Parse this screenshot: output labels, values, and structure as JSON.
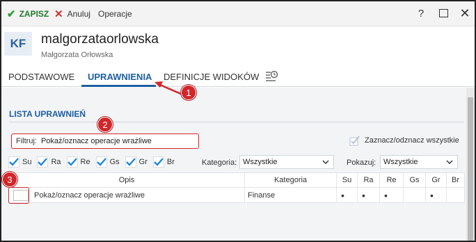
{
  "toolbar": {
    "save_label": "ZAPISZ",
    "cancel_label": "Anuluj",
    "operations_label": "Operacje"
  },
  "header": {
    "avatar_initials": "KF",
    "login": "malgorzataorlowska",
    "full_name": "Małgorzata Orłowska"
  },
  "tabs": [
    {
      "label": "PODSTAWOWE",
      "active": false
    },
    {
      "label": "UPRAWNIENIA",
      "active": true
    },
    {
      "label": "DEFINICJE WIDOKÓW",
      "active": false
    },
    {
      "label": "",
      "icon": "history-icon",
      "active": false
    }
  ],
  "section": {
    "title": "LISTA UPRAWNIEŃ"
  },
  "filter": {
    "label": "Filtruj:",
    "value": "Pokaż/oznacz operacje wrażliwe"
  },
  "select_all": {
    "label": "Zaznacz/odznacz wszystkie"
  },
  "permission_checks": [
    {
      "label": "Su",
      "checked": true
    },
    {
      "label": "Ra",
      "checked": true
    },
    {
      "label": "Re",
      "checked": true
    },
    {
      "label": "Gs",
      "checked": true
    },
    {
      "label": "Gr",
      "checked": true
    },
    {
      "label": "Br",
      "checked": true
    }
  ],
  "kategoria": {
    "label": "Kategoria:",
    "value": "Wszystkie"
  },
  "pokazuj": {
    "label": "Pokazuj:",
    "value": "Wszystkie"
  },
  "grid": {
    "columns": [
      "Opis",
      "Kategoria",
      "Su",
      "Ra",
      "Re",
      "Gs",
      "Gr",
      "Br"
    ],
    "rows": [
      {
        "checked": false,
        "opis": "Pokaż/oznacz operacje wrażliwe",
        "kategoria": "Finanse",
        "su": "•",
        "ra": "•",
        "re": "•",
        "gs": "",
        "gr": "•",
        "br": ""
      }
    ]
  },
  "annotations": {
    "badge_1": "1",
    "badge_2": "2",
    "badge_3": "3"
  },
  "colors": {
    "accent": "#1d5fa3",
    "save_green": "#2e9e3a",
    "cancel_red": "#d0302a",
    "annotation_red": "#d2272a",
    "check_blue": "#1e88d6"
  }
}
